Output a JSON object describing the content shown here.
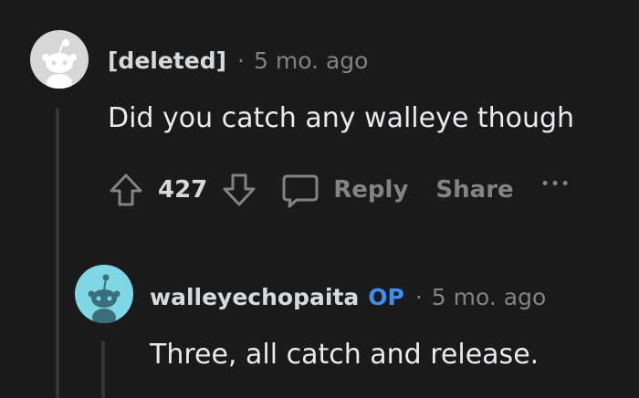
{
  "comments": [
    {
      "author": "[deleted]",
      "separator": "·",
      "age": "5 mo. ago",
      "body": "Did you catch any walleye though",
      "score": "427",
      "reply_label": "Reply",
      "share_label": "Share",
      "more_label": "•••"
    },
    {
      "author": "walleyechopaita",
      "op_badge": "OP",
      "separator": "·",
      "age": "5 mo. ago",
      "body": "Three, all catch and release."
    }
  ],
  "colors": {
    "background": "#1a1a1b",
    "text": "#d7dadc",
    "muted": "#818384",
    "op": "#3d8ef0",
    "thread_line": "#343536",
    "deleted_avatar_bg": "#d7d7d7",
    "user_avatar_bg": "#7fd7e6"
  },
  "icons": {
    "upvote": "upvote-arrow-icon",
    "downvote": "downvote-arrow-icon",
    "reply": "speech-bubble-icon",
    "more": "more-dots-icon",
    "avatar_deleted": "snoo-avatar-icon",
    "avatar_user": "snoo-avatar-icon"
  }
}
